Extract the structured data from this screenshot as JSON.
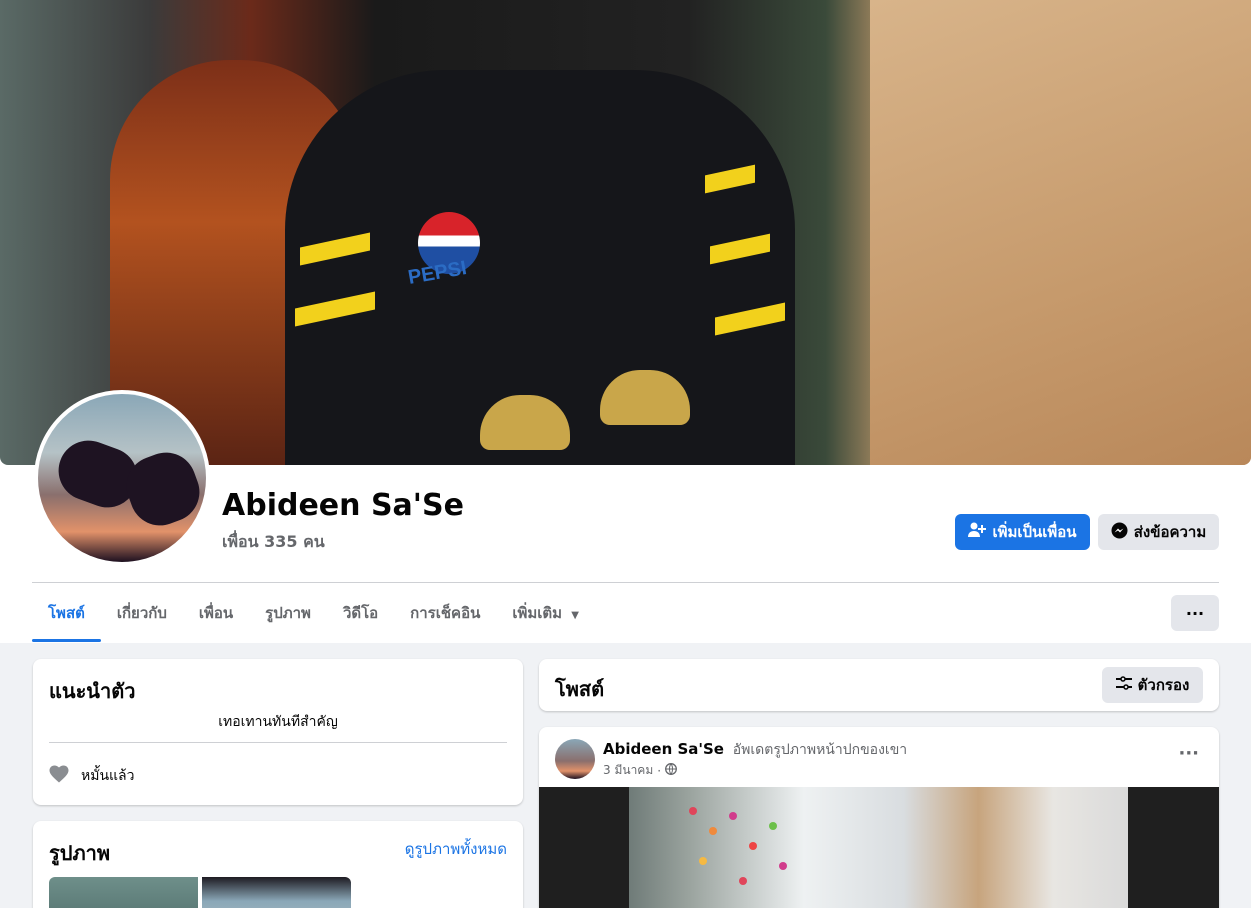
{
  "profile": {
    "name": "Abideen Sa'Se",
    "friends": "เพื่อน 335 คน"
  },
  "actions": {
    "add_friend": "เพิ่มเป็นเพื่อน",
    "message": "ส่งข้อความ",
    "more": "···"
  },
  "tabs": [
    {
      "label": "โพสต์",
      "active": true
    },
    {
      "label": "เกี่ยวกับ"
    },
    {
      "label": "เพื่อน"
    },
    {
      "label": "รูปภาพ"
    },
    {
      "label": "วิดีโอ"
    },
    {
      "label": "การเช็คอิน"
    },
    {
      "label": "เพิ่มเติม"
    }
  ],
  "intro": {
    "title": "แนะนำตัว",
    "bio": "เทอเทานทันทีสำคัญ",
    "relationship": "หมั้นแล้ว"
  },
  "photos": {
    "title": "รูปภาพ",
    "see_all": "ดูรูปภาพทั้งหมด"
  },
  "posts": {
    "title": "โพสต์",
    "filter": "ตัวกรอง"
  },
  "post": {
    "author": "Abideen Sa'Se",
    "action": "อัพเดตรูปภาพหน้าปกของเขา",
    "date": "3 มีนาคม",
    "sep": "·",
    "more": "···"
  },
  "cover_text": {
    "brand": "PEPSI"
  },
  "colors": {
    "accent": "#1b74e4",
    "secondary_button": "#e4e6eb",
    "page_background": "#f0f2f5",
    "muted_text": "#65676b"
  },
  "icons": [
    "add-friend-icon",
    "messenger-icon",
    "chevron-down-icon",
    "heart-icon",
    "filter-icon",
    "globe-icon",
    "more-icon"
  ]
}
